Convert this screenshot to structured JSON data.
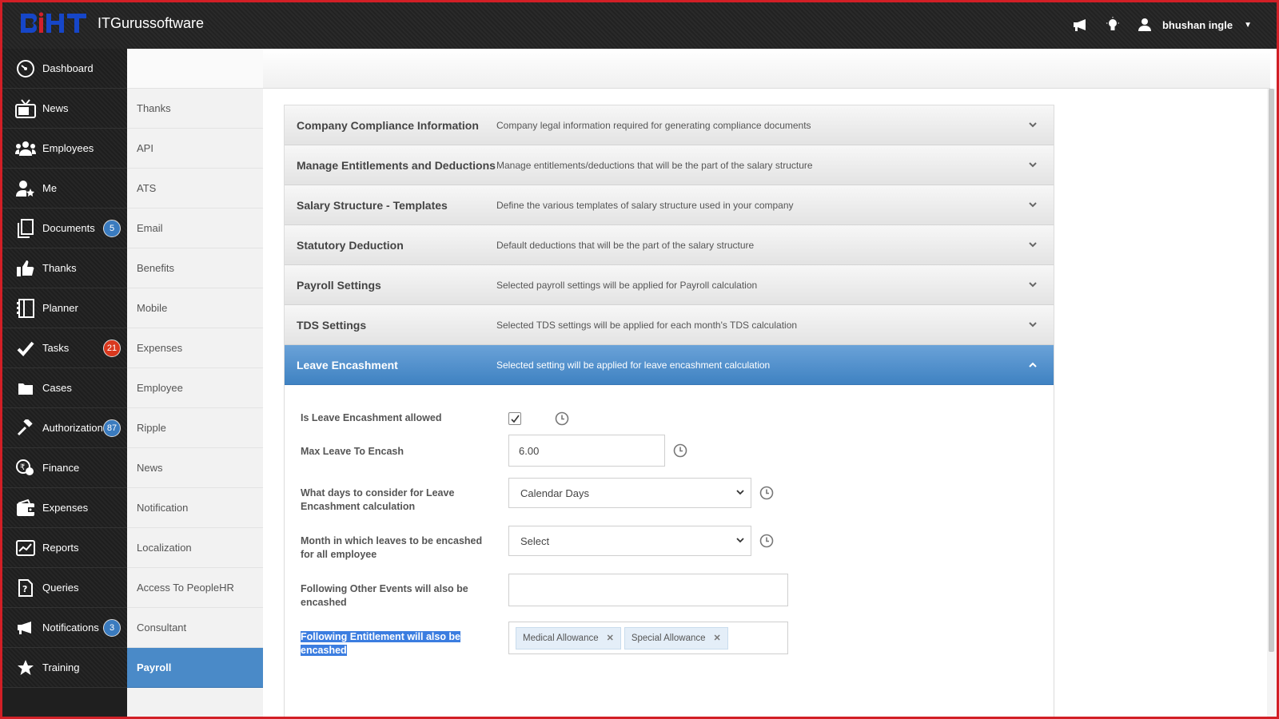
{
  "app": {
    "company_name": "ITGurussoftware",
    "user_name": "bhushan ingle",
    "logo_text": "BIHT"
  },
  "colors": {
    "accent": "#4a8ac8",
    "badge_blue": "#3a7bbf",
    "badge_red": "#d9381e",
    "window_border": "#d21f26"
  },
  "sidebar": {
    "items": [
      {
        "label": "Dashboard",
        "icon": "dashboard-gauge-icon"
      },
      {
        "label": "News",
        "icon": "tv-icon"
      },
      {
        "label": "Employees",
        "icon": "people-icon"
      },
      {
        "label": "Me",
        "icon": "user-star-icon"
      },
      {
        "label": "Documents",
        "icon": "documents-icon",
        "badge": "5",
        "badge_color": "blue"
      },
      {
        "label": "Thanks",
        "icon": "thumbs-up-icon"
      },
      {
        "label": "Planner",
        "icon": "planner-icon"
      },
      {
        "label": "Tasks",
        "icon": "check-icon",
        "badge": "21",
        "badge_color": "red"
      },
      {
        "label": "Cases",
        "icon": "folder-icon"
      },
      {
        "label": "Authorizations",
        "icon": "gavel-icon",
        "badge": "87",
        "badge_color": "blue"
      },
      {
        "label": "Finance",
        "icon": "rupee-coins-icon"
      },
      {
        "label": "Expenses",
        "icon": "wallet-icon"
      },
      {
        "label": "Reports",
        "icon": "chart-line-icon"
      },
      {
        "label": "Queries",
        "icon": "question-doc-icon"
      },
      {
        "label": "Notifications",
        "icon": "megaphone-icon",
        "badge": "3",
        "badge_color": "blue"
      },
      {
        "label": "Training",
        "icon": "star-icon"
      }
    ]
  },
  "subnav": {
    "items": [
      "Thanks",
      "API",
      "ATS",
      "Email",
      "Benefits",
      "Mobile",
      "Expenses",
      "Employee",
      "Ripple",
      "News",
      "Notification",
      "Localization",
      "Access To PeopleHR",
      "Consultant",
      "Payroll"
    ],
    "active": "Payroll"
  },
  "accordion": [
    {
      "title": "Company Compliance Information",
      "desc": "Company legal information required for generating compliance documents"
    },
    {
      "title": "Manage Entitlements and Deductions",
      "desc": "Manage entitlements/deductions that will be the part of the salary structure"
    },
    {
      "title": "Salary Structure - Templates",
      "desc": "Define the various templates of salary structure used in your company"
    },
    {
      "title": "Statutory Deduction",
      "desc": "Default deductions that will be the part of the salary structure"
    },
    {
      "title": "Payroll Settings",
      "desc": "Selected payroll settings will be applied for Payroll calculation"
    },
    {
      "title": "TDS Settings",
      "desc": "Selected TDS settings will be applied for each month's TDS calculation"
    },
    {
      "title": "Leave Encashment",
      "desc": "Selected setting will be applied for leave encashment calculation",
      "expanded": true
    }
  ],
  "form": {
    "leave_allowed_label": "Is Leave Encashment allowed",
    "leave_allowed_checked": true,
    "max_leave_label": "Max Leave To Encash",
    "max_leave_value": "6.00",
    "days_label": "What days to consider for Leave Encashment calculation",
    "days_value": "Calendar Days",
    "month_label": "Month in which leaves to be encashed for all employee",
    "month_value": "Select",
    "other_events_label": "Following Other Events will also be encashed",
    "other_events_value": "",
    "entitlement_label": "Following Entitlement will also be encashed",
    "entitlement_tags": [
      "Medical Allowance",
      "Special Allowance"
    ]
  }
}
